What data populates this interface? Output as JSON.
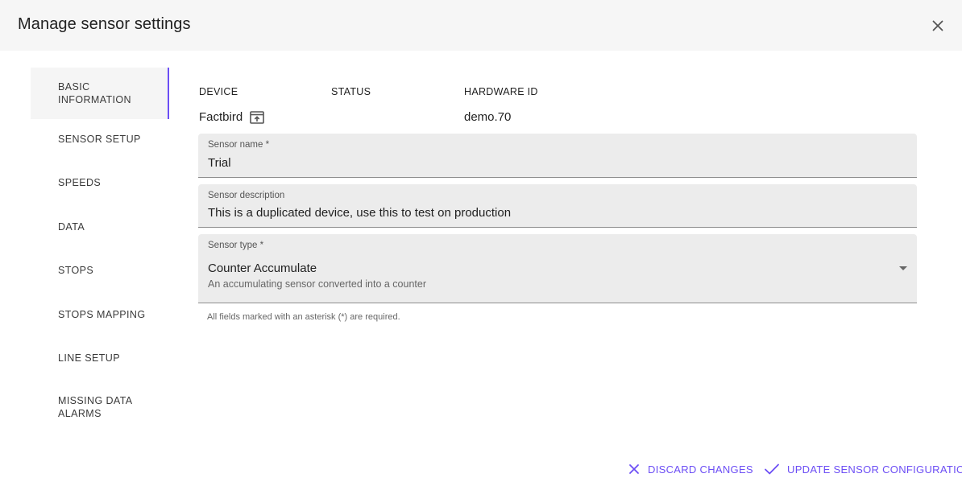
{
  "dialog": {
    "title": "Manage sensor settings",
    "close_icon": "close-icon"
  },
  "nav": {
    "active_index": 0,
    "items": [
      {
        "label": "BASIC INFORMATION"
      },
      {
        "label": "SENSOR SETUP"
      },
      {
        "label": "SPEEDS"
      },
      {
        "label": "DATA"
      },
      {
        "label": "STOPS"
      },
      {
        "label": "STOPS MAPPING"
      },
      {
        "label": "LINE SETUP"
      },
      {
        "label": "MISSING DATA ALARMS"
      }
    ]
  },
  "info": {
    "device_header": "DEVICE",
    "status_header": "STATUS",
    "hardware_header": "HARDWARE ID",
    "device_value": "Factbird",
    "device_icon": "open-in-new-icon",
    "status_value": "",
    "hardware_value": "demo.70"
  },
  "form": {
    "name_label": "Sensor name *",
    "name_value": "Trial",
    "description_label": "Sensor description",
    "description_value": "This is a duplicated device, use this to test on production",
    "type_label": "Sensor type *",
    "type_value": "Counter Accumulate",
    "type_subtext": "An accumulating sensor converted into a counter",
    "required_hint": "All fields marked with an asterisk (*) are required."
  },
  "actions": {
    "discard_label": "DISCARD CHANGES",
    "update_label": "UPDATE SENSOR CONFIGURATION"
  },
  "colors": {
    "accent": "#6c4ef5",
    "header_bg": "#f6f6f6",
    "field_bg": "#ececec"
  }
}
